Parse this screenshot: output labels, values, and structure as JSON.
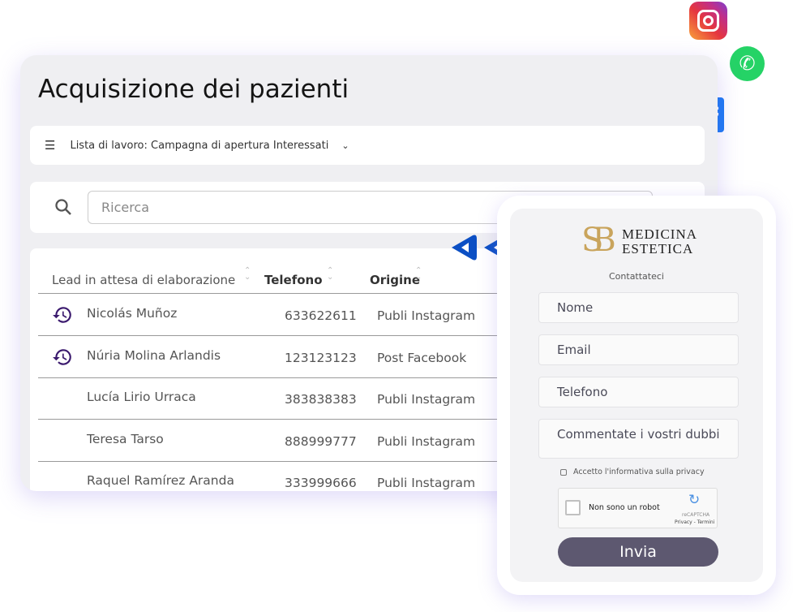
{
  "main": {
    "title": "Acquisizione dei pazienti",
    "worklist": "Lista di lavoro: Campagna di apertura Interessati",
    "search_placeholder": "Ricerca",
    "columns": [
      "Lead in attesa di elaborazione",
      "Telefono",
      "Origine"
    ],
    "rows": [
      {
        "name": "Nicolás Muñoz",
        "phone": "633622611",
        "origin": "Publi Instagram",
        "pending": true
      },
      {
        "name": "Núria Molina Arlandis",
        "phone": "123123123",
        "origin": "Post Facebook",
        "pending": true
      },
      {
        "name": "Lucía Lirio Urraca",
        "phone": "383838383",
        "origin": "Publi Instagram",
        "pending": false
      },
      {
        "name": "Teresa Tarso",
        "phone": "888999777",
        "origin": "Publi Instagram",
        "pending": false
      },
      {
        "name": "Raquel Ramírez Aranda",
        "phone": "333999666",
        "origin": "Publi Instagram",
        "pending": false
      }
    ]
  },
  "form": {
    "logo": "MEDICINA ESTETICA",
    "logo_line1": "MEDICINA",
    "logo_line2": "ESTETICA",
    "heading": "Contattateci",
    "fields": [
      "Nome",
      "Email",
      "Telefono",
      "Commentate i vostri dubbi"
    ],
    "privacy": "Accetto l'informativa sulla privacy",
    "captcha": "Non sono un robot",
    "captcha_brand": "reCAPTCHA",
    "captcha_links": "Privacy - Termini",
    "submit": "Invia"
  },
  "colors": {
    "accent": "#0b4fc4",
    "history": "#3b1a6e",
    "button": "#5d5870"
  },
  "social": [
    "instagram-icon",
    "whatsapp-icon",
    "facebook-icon"
  ]
}
